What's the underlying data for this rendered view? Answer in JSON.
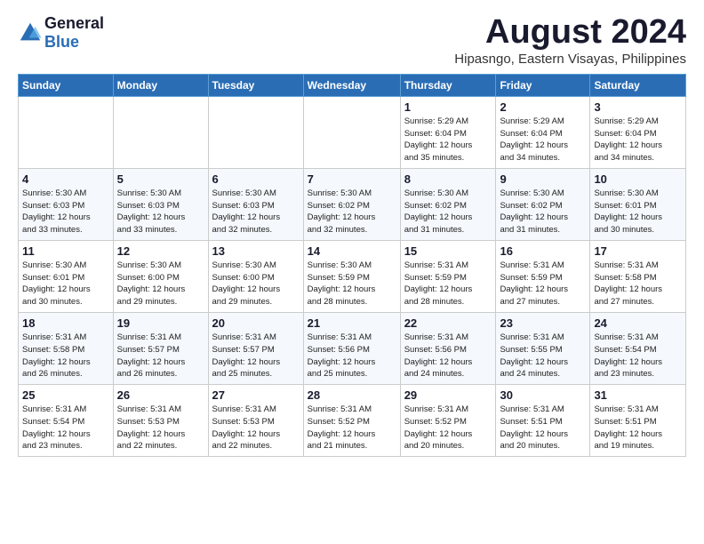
{
  "header": {
    "logo_line1": "General",
    "logo_line2": "Blue",
    "title": "August 2024",
    "subtitle": "Hipasngo, Eastern Visayas, Philippines"
  },
  "days_of_week": [
    "Sunday",
    "Monday",
    "Tuesday",
    "Wednesday",
    "Thursday",
    "Friday",
    "Saturday"
  ],
  "weeks": [
    [
      {
        "day": "",
        "info": ""
      },
      {
        "day": "",
        "info": ""
      },
      {
        "day": "",
        "info": ""
      },
      {
        "day": "",
        "info": ""
      },
      {
        "day": "1",
        "info": "Sunrise: 5:29 AM\nSunset: 6:04 PM\nDaylight: 12 hours\nand 35 minutes."
      },
      {
        "day": "2",
        "info": "Sunrise: 5:29 AM\nSunset: 6:04 PM\nDaylight: 12 hours\nand 34 minutes."
      },
      {
        "day": "3",
        "info": "Sunrise: 5:29 AM\nSunset: 6:04 PM\nDaylight: 12 hours\nand 34 minutes."
      }
    ],
    [
      {
        "day": "4",
        "info": "Sunrise: 5:30 AM\nSunset: 6:03 PM\nDaylight: 12 hours\nand 33 minutes."
      },
      {
        "day": "5",
        "info": "Sunrise: 5:30 AM\nSunset: 6:03 PM\nDaylight: 12 hours\nand 33 minutes."
      },
      {
        "day": "6",
        "info": "Sunrise: 5:30 AM\nSunset: 6:03 PM\nDaylight: 12 hours\nand 32 minutes."
      },
      {
        "day": "7",
        "info": "Sunrise: 5:30 AM\nSunset: 6:02 PM\nDaylight: 12 hours\nand 32 minutes."
      },
      {
        "day": "8",
        "info": "Sunrise: 5:30 AM\nSunset: 6:02 PM\nDaylight: 12 hours\nand 31 minutes."
      },
      {
        "day": "9",
        "info": "Sunrise: 5:30 AM\nSunset: 6:02 PM\nDaylight: 12 hours\nand 31 minutes."
      },
      {
        "day": "10",
        "info": "Sunrise: 5:30 AM\nSunset: 6:01 PM\nDaylight: 12 hours\nand 30 minutes."
      }
    ],
    [
      {
        "day": "11",
        "info": "Sunrise: 5:30 AM\nSunset: 6:01 PM\nDaylight: 12 hours\nand 30 minutes."
      },
      {
        "day": "12",
        "info": "Sunrise: 5:30 AM\nSunset: 6:00 PM\nDaylight: 12 hours\nand 29 minutes."
      },
      {
        "day": "13",
        "info": "Sunrise: 5:30 AM\nSunset: 6:00 PM\nDaylight: 12 hours\nand 29 minutes."
      },
      {
        "day": "14",
        "info": "Sunrise: 5:30 AM\nSunset: 5:59 PM\nDaylight: 12 hours\nand 28 minutes."
      },
      {
        "day": "15",
        "info": "Sunrise: 5:31 AM\nSunset: 5:59 PM\nDaylight: 12 hours\nand 28 minutes."
      },
      {
        "day": "16",
        "info": "Sunrise: 5:31 AM\nSunset: 5:59 PM\nDaylight: 12 hours\nand 27 minutes."
      },
      {
        "day": "17",
        "info": "Sunrise: 5:31 AM\nSunset: 5:58 PM\nDaylight: 12 hours\nand 27 minutes."
      }
    ],
    [
      {
        "day": "18",
        "info": "Sunrise: 5:31 AM\nSunset: 5:58 PM\nDaylight: 12 hours\nand 26 minutes."
      },
      {
        "day": "19",
        "info": "Sunrise: 5:31 AM\nSunset: 5:57 PM\nDaylight: 12 hours\nand 26 minutes."
      },
      {
        "day": "20",
        "info": "Sunrise: 5:31 AM\nSunset: 5:57 PM\nDaylight: 12 hours\nand 25 minutes."
      },
      {
        "day": "21",
        "info": "Sunrise: 5:31 AM\nSunset: 5:56 PM\nDaylight: 12 hours\nand 25 minutes."
      },
      {
        "day": "22",
        "info": "Sunrise: 5:31 AM\nSunset: 5:56 PM\nDaylight: 12 hours\nand 24 minutes."
      },
      {
        "day": "23",
        "info": "Sunrise: 5:31 AM\nSunset: 5:55 PM\nDaylight: 12 hours\nand 24 minutes."
      },
      {
        "day": "24",
        "info": "Sunrise: 5:31 AM\nSunset: 5:54 PM\nDaylight: 12 hours\nand 23 minutes."
      }
    ],
    [
      {
        "day": "25",
        "info": "Sunrise: 5:31 AM\nSunset: 5:54 PM\nDaylight: 12 hours\nand 23 minutes."
      },
      {
        "day": "26",
        "info": "Sunrise: 5:31 AM\nSunset: 5:53 PM\nDaylight: 12 hours\nand 22 minutes."
      },
      {
        "day": "27",
        "info": "Sunrise: 5:31 AM\nSunset: 5:53 PM\nDaylight: 12 hours\nand 22 minutes."
      },
      {
        "day": "28",
        "info": "Sunrise: 5:31 AM\nSunset: 5:52 PM\nDaylight: 12 hours\nand 21 minutes."
      },
      {
        "day": "29",
        "info": "Sunrise: 5:31 AM\nSunset: 5:52 PM\nDaylight: 12 hours\nand 20 minutes."
      },
      {
        "day": "30",
        "info": "Sunrise: 5:31 AM\nSunset: 5:51 PM\nDaylight: 12 hours\nand 20 minutes."
      },
      {
        "day": "31",
        "info": "Sunrise: 5:31 AM\nSunset: 5:51 PM\nDaylight: 12 hours\nand 19 minutes."
      }
    ]
  ]
}
